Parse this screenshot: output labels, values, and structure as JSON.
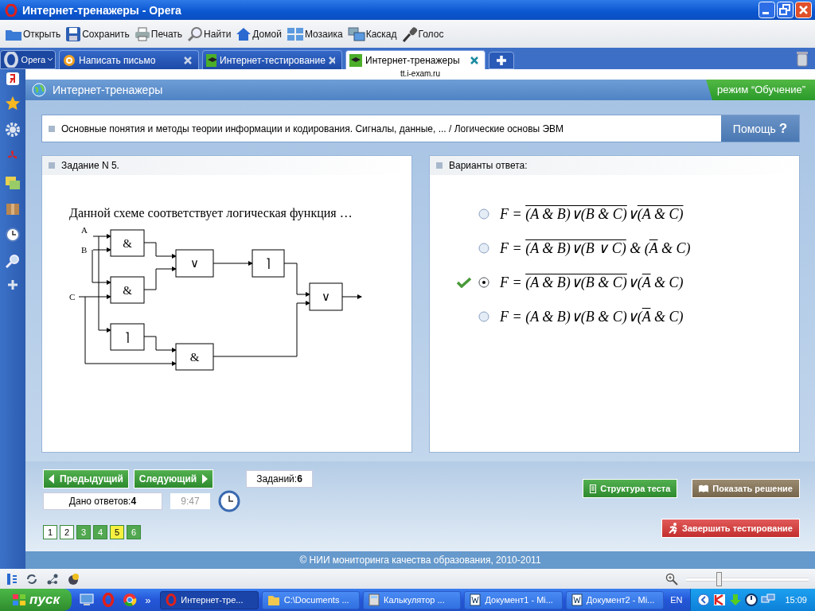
{
  "window": {
    "title": "Интернет-тренажеры - Opera"
  },
  "toolbar": [
    {
      "label": "Открыть",
      "kind": "folder"
    },
    {
      "label": "Сохранить",
      "kind": "save"
    },
    {
      "label": "Печать",
      "kind": "print"
    },
    {
      "label": "Найти",
      "kind": "search"
    },
    {
      "label": "Домой",
      "kind": "home"
    },
    {
      "label": "Мозаика",
      "kind": "tile"
    },
    {
      "label": "Каскад",
      "kind": "cascade"
    },
    {
      "label": "Голос",
      "kind": "mic"
    }
  ],
  "menu_button": {
    "label": "Opera"
  },
  "tabs": [
    {
      "label": "Написать письмо",
      "kind": "mail",
      "selected": false
    },
    {
      "label": "Интернет-тестирование",
      "kind": "site",
      "selected": false
    },
    {
      "label": "Интернет-тренажеры",
      "kind": "site",
      "selected": true
    }
  ],
  "address": "tt.i-exam.ru",
  "site": {
    "title": "Интернет-тренажеры",
    "mode": "режим “Обучение”"
  },
  "breadcrumb": {
    "text": "Основные понятия и методы теории информации и кодирования. Сигналы, данные, ... / Логические основы ЭВМ",
    "help": "Помощь",
    "help_mark": "?"
  },
  "task": {
    "title": "Задание N 5.",
    "question": "Данной схеме соответствует логическая функция …",
    "diagram": {
      "inputs": [
        "A",
        "B",
        "C"
      ],
      "gates": [
        "&",
        "&",
        "∨",
        "⌉",
        "⌉",
        "&",
        "∨"
      ]
    }
  },
  "answers": {
    "title": "Варианты ответа:",
    "options": [
      {
        "selected": false,
        "correct": false,
        "parts": [
          {
            "text": "F = ",
            "overline": false
          },
          {
            "text": "(A & B)∨(B & C)",
            "overline": true
          },
          {
            "text": "∨",
            "overline": false
          },
          {
            "text": "(A & C)",
            "overline": true
          }
        ]
      },
      {
        "selected": false,
        "correct": false,
        "parts": [
          {
            "text": "F = ",
            "overline": false
          },
          {
            "text": "(A & B)∨(B ∨ C)",
            "overline": true
          },
          {
            "text": " & (",
            "overline": false
          },
          {
            "text": "A",
            "overline": true
          },
          {
            "text": " & C)",
            "overline": false
          }
        ]
      },
      {
        "selected": true,
        "correct": true,
        "parts": [
          {
            "text": "F = ",
            "overline": false
          },
          {
            "text": "(A & B)∨(B & C)",
            "overline": true
          },
          {
            "text": "∨(",
            "overline": false
          },
          {
            "text": "A",
            "overline": true
          },
          {
            "text": " & C)",
            "overline": false
          }
        ]
      },
      {
        "selected": false,
        "correct": false,
        "parts": [
          {
            "text": "F = (A & B)∨(B & C)∨(",
            "overline": false
          },
          {
            "text": "A",
            "overline": true
          },
          {
            "text": " & C)",
            "overline": false
          }
        ]
      }
    ]
  },
  "nav": {
    "prev": "Предыдущий",
    "next": "Следующий",
    "total_label": "Заданий:",
    "total": "6",
    "answered_label": "Дано ответов:",
    "answered": "4",
    "timer": "9:47",
    "structure": "Структура теста",
    "solution": "Показать решение",
    "finish": "Завершить тестирование"
  },
  "pages": [
    {
      "label": "1",
      "answered": false,
      "selected": false
    },
    {
      "label": "2",
      "answered": false,
      "selected": false
    },
    {
      "label": "3",
      "answered": true,
      "selected": false
    },
    {
      "label": "4",
      "answered": true,
      "selected": false
    },
    {
      "label": "5",
      "answered": true,
      "selected": true
    },
    {
      "label": "6",
      "answered": true,
      "selected": false
    }
  ],
  "footer": "© НИИ мониторинга качества образования, 2010-2011",
  "zoom": {
    "level": 0.27
  },
  "taskbar": {
    "start": "пуск",
    "more": "»",
    "tasks": [
      {
        "label": "Интернет-тре...",
        "kind": "opera",
        "selected": true
      },
      {
        "label": "C:\\Documents ...",
        "kind": "folder",
        "selected": false
      },
      {
        "label": "Калькулятор ...",
        "kind": "calc",
        "selected": false
      },
      {
        "label": "Документ1 - Mi...",
        "kind": "word",
        "selected": false
      },
      {
        "label": "Документ2 - Mi...",
        "kind": "word",
        "selected": false
      }
    ],
    "lang": "EN",
    "clock": "15:09"
  }
}
